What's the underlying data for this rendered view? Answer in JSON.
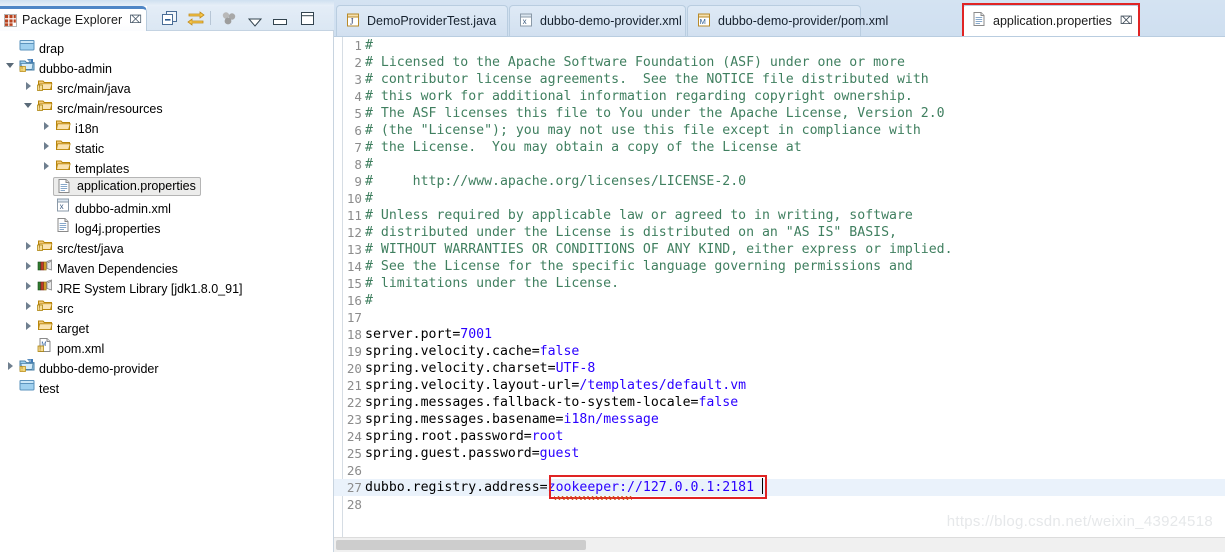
{
  "explorer": {
    "tab_title": "Package Explorer",
    "tab_icon": "package-explorer-icon",
    "close_label": "⌧",
    "toolbar": [
      {
        "name": "collapse-all-icon",
        "label": "Collapse All"
      },
      {
        "name": "link-with-editor-icon",
        "label": "Link with Editor"
      },
      {
        "name": "view-filter-icon",
        "label": "Filters"
      },
      {
        "name": "view-menu-chevron-icon",
        "label": "View Menu"
      },
      {
        "name": "minimize-icon",
        "label": "Minimize"
      },
      {
        "name": "maximize-icon",
        "label": "Maximize"
      }
    ],
    "tree": [
      {
        "label": "drap",
        "icon": "closed-project-icon",
        "indent": 0,
        "arrow": "none",
        "selected": false
      },
      {
        "label": "dubbo-admin",
        "icon": "maven-project-icon",
        "indent": 0,
        "arrow": "expanded",
        "selected": false
      },
      {
        "label": "src/main/java",
        "icon": "source-folder-icon",
        "indent": 1,
        "arrow": "collapsed",
        "selected": false
      },
      {
        "label": "src/main/resources",
        "icon": "source-folder-icon",
        "indent": 1,
        "arrow": "expanded",
        "selected": false
      },
      {
        "label": "i18n",
        "icon": "folder-icon",
        "indent": 2,
        "arrow": "collapsed",
        "selected": false
      },
      {
        "label": "static",
        "icon": "folder-icon",
        "indent": 2,
        "arrow": "collapsed",
        "selected": false
      },
      {
        "label": "templates",
        "icon": "folder-icon",
        "indent": 2,
        "arrow": "collapsed",
        "selected": false
      },
      {
        "label": "application.properties",
        "icon": "properties-file-icon",
        "indent": 2,
        "arrow": "none",
        "selected": true
      },
      {
        "label": "dubbo-admin.xml",
        "icon": "xml-file-icon",
        "indent": 2,
        "arrow": "none",
        "selected": false
      },
      {
        "label": "log4j.properties",
        "icon": "properties-file-icon",
        "indent": 2,
        "arrow": "none",
        "selected": false
      },
      {
        "label": "src/test/java",
        "icon": "source-folder-icon",
        "indent": 1,
        "arrow": "collapsed",
        "selected": false
      },
      {
        "label": "Maven Dependencies",
        "icon": "library-icon",
        "indent": 1,
        "arrow": "collapsed",
        "selected": false
      },
      {
        "label": "JRE System Library ",
        "dim": "[jdk1.8.0_91]",
        "icon": "library-icon",
        "indent": 1,
        "arrow": "collapsed",
        "selected": false
      },
      {
        "label": "src",
        "icon": "source-folder-icon",
        "indent": 1,
        "arrow": "collapsed",
        "selected": false
      },
      {
        "label": "target",
        "icon": "folder-icon",
        "indent": 1,
        "arrow": "collapsed",
        "selected": false
      },
      {
        "label": "pom.xml",
        "icon": "pom-file-icon",
        "indent": 1,
        "arrow": "none",
        "selected": false
      },
      {
        "label": "dubbo-demo-provider",
        "icon": "maven-project-icon",
        "indent": 0,
        "arrow": "collapsed",
        "selected": false
      },
      {
        "label": "test",
        "icon": "closed-project-icon",
        "indent": 0,
        "arrow": "none",
        "selected": false
      }
    ]
  },
  "editor": {
    "tabs": [
      {
        "label": "DemoProviderTest.java",
        "icon": "java-file-icon",
        "active": false,
        "closable": false
      },
      {
        "label": "dubbo-demo-provider.xml",
        "icon": "xml-file-icon",
        "active": false,
        "closable": false
      },
      {
        "label": "dubbo-demo-provider/pom.xml",
        "icon": "pom-file-icon",
        "active": false,
        "closable": false
      },
      {
        "label": "application.properties",
        "icon": "properties-file-icon",
        "active": true,
        "closable": true
      }
    ],
    "tab_close_label": "⌧",
    "lines": [
      {
        "n": "1",
        "segments": [
          {
            "t": "#",
            "c": "cm"
          }
        ]
      },
      {
        "n": "2",
        "segments": [
          {
            "t": "# Licensed to the Apache Software Foundation (ASF) under one or more",
            "c": "cm"
          }
        ]
      },
      {
        "n": "3",
        "segments": [
          {
            "t": "# contributor license agreements.  See the NOTICE file distributed with",
            "c": "cm"
          }
        ]
      },
      {
        "n": "4",
        "segments": [
          {
            "t": "# this work for additional information regarding copyright ownership.",
            "c": "cm"
          }
        ]
      },
      {
        "n": "5",
        "segments": [
          {
            "t": "# The ASF licenses this file to You under the Apache License, Version 2.0",
            "c": "cm"
          }
        ]
      },
      {
        "n": "6",
        "segments": [
          {
            "t": "# (the \"License\"); you may not use this file except in compliance with",
            "c": "cm"
          }
        ]
      },
      {
        "n": "7",
        "segments": [
          {
            "t": "# the License.  You may obtain a copy of the License at",
            "c": "cm"
          }
        ]
      },
      {
        "n": "8",
        "segments": [
          {
            "t": "#",
            "c": "cm"
          }
        ]
      },
      {
        "n": "9",
        "segments": [
          {
            "t": "#     http://www.apache.org/licenses/LICENSE-2.0",
            "c": "cm"
          }
        ]
      },
      {
        "n": "10",
        "segments": [
          {
            "t": "#",
            "c": "cm"
          }
        ]
      },
      {
        "n": "11",
        "segments": [
          {
            "t": "# Unless required by applicable law or agreed to in writing, software",
            "c": "cm"
          }
        ]
      },
      {
        "n": "12",
        "segments": [
          {
            "t": "# distributed under the License is distributed on an \"AS IS\" BASIS,",
            "c": "cm"
          }
        ]
      },
      {
        "n": "13",
        "segments": [
          {
            "t": "# WITHOUT WARRANTIES OR CONDITIONS OF ANY KIND, either express or implied.",
            "c": "cm"
          }
        ]
      },
      {
        "n": "14",
        "segments": [
          {
            "t": "# See the License for the specific language governing permissions and",
            "c": "cm"
          }
        ]
      },
      {
        "n": "15",
        "segments": [
          {
            "t": "# limitations under the License.",
            "c": "cm"
          }
        ]
      },
      {
        "n": "16",
        "segments": [
          {
            "t": "#",
            "c": "cm"
          }
        ]
      },
      {
        "n": "17",
        "segments": []
      },
      {
        "n": "18",
        "segments": [
          {
            "t": "server.port=",
            "c": "key"
          },
          {
            "t": "7001",
            "c": "val"
          }
        ]
      },
      {
        "n": "19",
        "segments": [
          {
            "t": "spring.velocity.cache=",
            "c": "key"
          },
          {
            "t": "false",
            "c": "val"
          }
        ]
      },
      {
        "n": "20",
        "segments": [
          {
            "t": "spring.velocity.charset=",
            "c": "key"
          },
          {
            "t": "UTF-8",
            "c": "val"
          }
        ]
      },
      {
        "n": "21",
        "segments": [
          {
            "t": "spring.velocity.layout-url=",
            "c": "key"
          },
          {
            "t": "/templates/default.vm",
            "c": "val"
          }
        ]
      },
      {
        "n": "22",
        "segments": [
          {
            "t": "spring.messages.fallback-to-system-locale=",
            "c": "key"
          },
          {
            "t": "false",
            "c": "val"
          }
        ]
      },
      {
        "n": "23",
        "segments": [
          {
            "t": "spring.messages.basename=",
            "c": "key"
          },
          {
            "t": "i18n/message",
            "c": "val"
          }
        ]
      },
      {
        "n": "24",
        "segments": [
          {
            "t": "spring.root.password=",
            "c": "key"
          },
          {
            "t": "root",
            "c": "val"
          }
        ]
      },
      {
        "n": "25",
        "segments": [
          {
            "t": "spring.guest.password=",
            "c": "key"
          },
          {
            "t": "guest",
            "c": "val"
          }
        ]
      },
      {
        "n": "26",
        "segments": []
      },
      {
        "n": "27",
        "segments": [
          {
            "t": "dubbo.registry.address=",
            "c": "key"
          },
          {
            "t": "zookeeper://127.0.0.1:2181",
            "c": "val"
          }
        ],
        "highlight": true
      },
      {
        "n": "28",
        "segments": []
      }
    ],
    "annotations": {
      "tab_highlight_color": "#e02424",
      "value_highlight_color": "#e02424",
      "comment_color": "#3f7f5f",
      "value_color": "#2a00ff",
      "current_line_color": "#eaf2fb"
    }
  },
  "watermark": "https://blog.csdn.net/weixin_43924518"
}
